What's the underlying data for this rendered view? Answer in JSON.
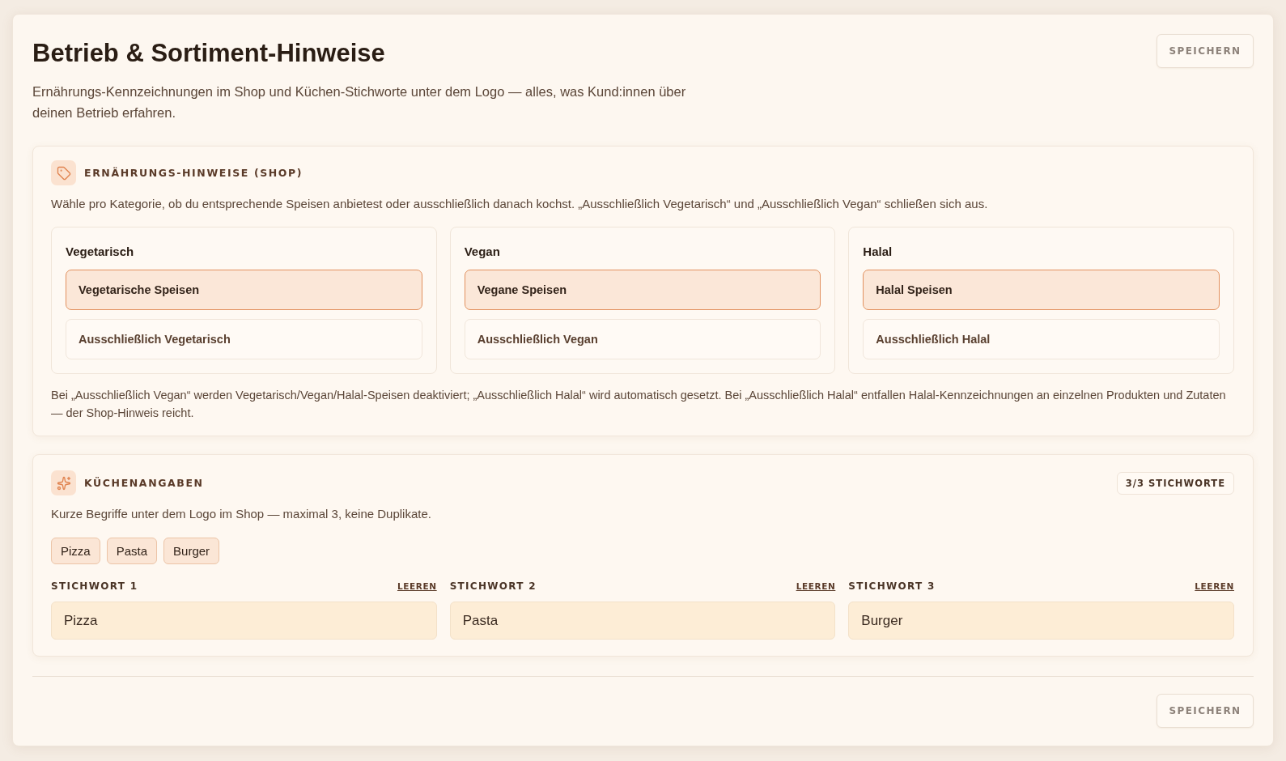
{
  "header": {
    "title": "Betrieb & Sortiment-Hinweise",
    "description": "Ernährungs-Kennzeichnungen im Shop und Küchen-Stichworte unter dem Logo — alles, was Kund:innen über deinen Betrieb erfahren.",
    "save_button": {
      "label": "SPEICHERN",
      "disabled": true
    }
  },
  "diet_section": {
    "heading": "ERNÄHRUNGS-HINWEISE (SHOP)",
    "description": "Wähle pro Kategorie, ob du entsprechende Speisen anbietest oder ausschließlich danach kochst. „Ausschließlich Vegetarisch“ und „Ausschließlich Vegan“ schließen sich aus.",
    "categories": [
      {
        "title": "Vegetarisch",
        "options": [
          {
            "label": "Vegetarische Speisen",
            "on": true
          },
          {
            "label": "Ausschließlich Vegetarisch",
            "on": false
          }
        ]
      },
      {
        "title": "Vegan",
        "options": [
          {
            "label": "Vegane Speisen",
            "on": true
          },
          {
            "label": "Ausschließlich Vegan",
            "on": false
          }
        ]
      },
      {
        "title": "Halal",
        "options": [
          {
            "label": "Halal Speisen",
            "on": true
          },
          {
            "label": "Ausschließlich Halal",
            "on": false
          }
        ]
      }
    ],
    "note": "Bei „Ausschließlich Vegan“ werden Vegetarisch/Vegan/Halal-Speisen deaktiviert; „Ausschließlich Halal“ wird automatisch gesetzt. Bei „Ausschließlich Halal“ entfallen Halal-Kennzeichnungen an einzelnen Produkten und Zutaten — der Shop-Hinweis reicht."
  },
  "cuisine_section": {
    "heading": "KÜCHENANGABEN",
    "count_badge": "3/3 STICHWORTE",
    "description": "Kurze Begriffe unter dem Logo im Shop — maximal 3, keine Duplikate.",
    "tags": [
      "Pizza",
      "Pasta",
      "Burger"
    ],
    "fields": [
      {
        "label": "STICHWORT 1",
        "clear_link": "LEEREN",
        "value": "Pizza"
      },
      {
        "label": "STICHWORT 2",
        "clear_link": "LEEREN",
        "value": "Pasta"
      },
      {
        "label": "STICHWORT 3",
        "clear_link": "LEEREN",
        "value": "Burger"
      }
    ]
  },
  "footer": {
    "save_button": {
      "label": "SPEICHERN",
      "disabled": true
    }
  }
}
